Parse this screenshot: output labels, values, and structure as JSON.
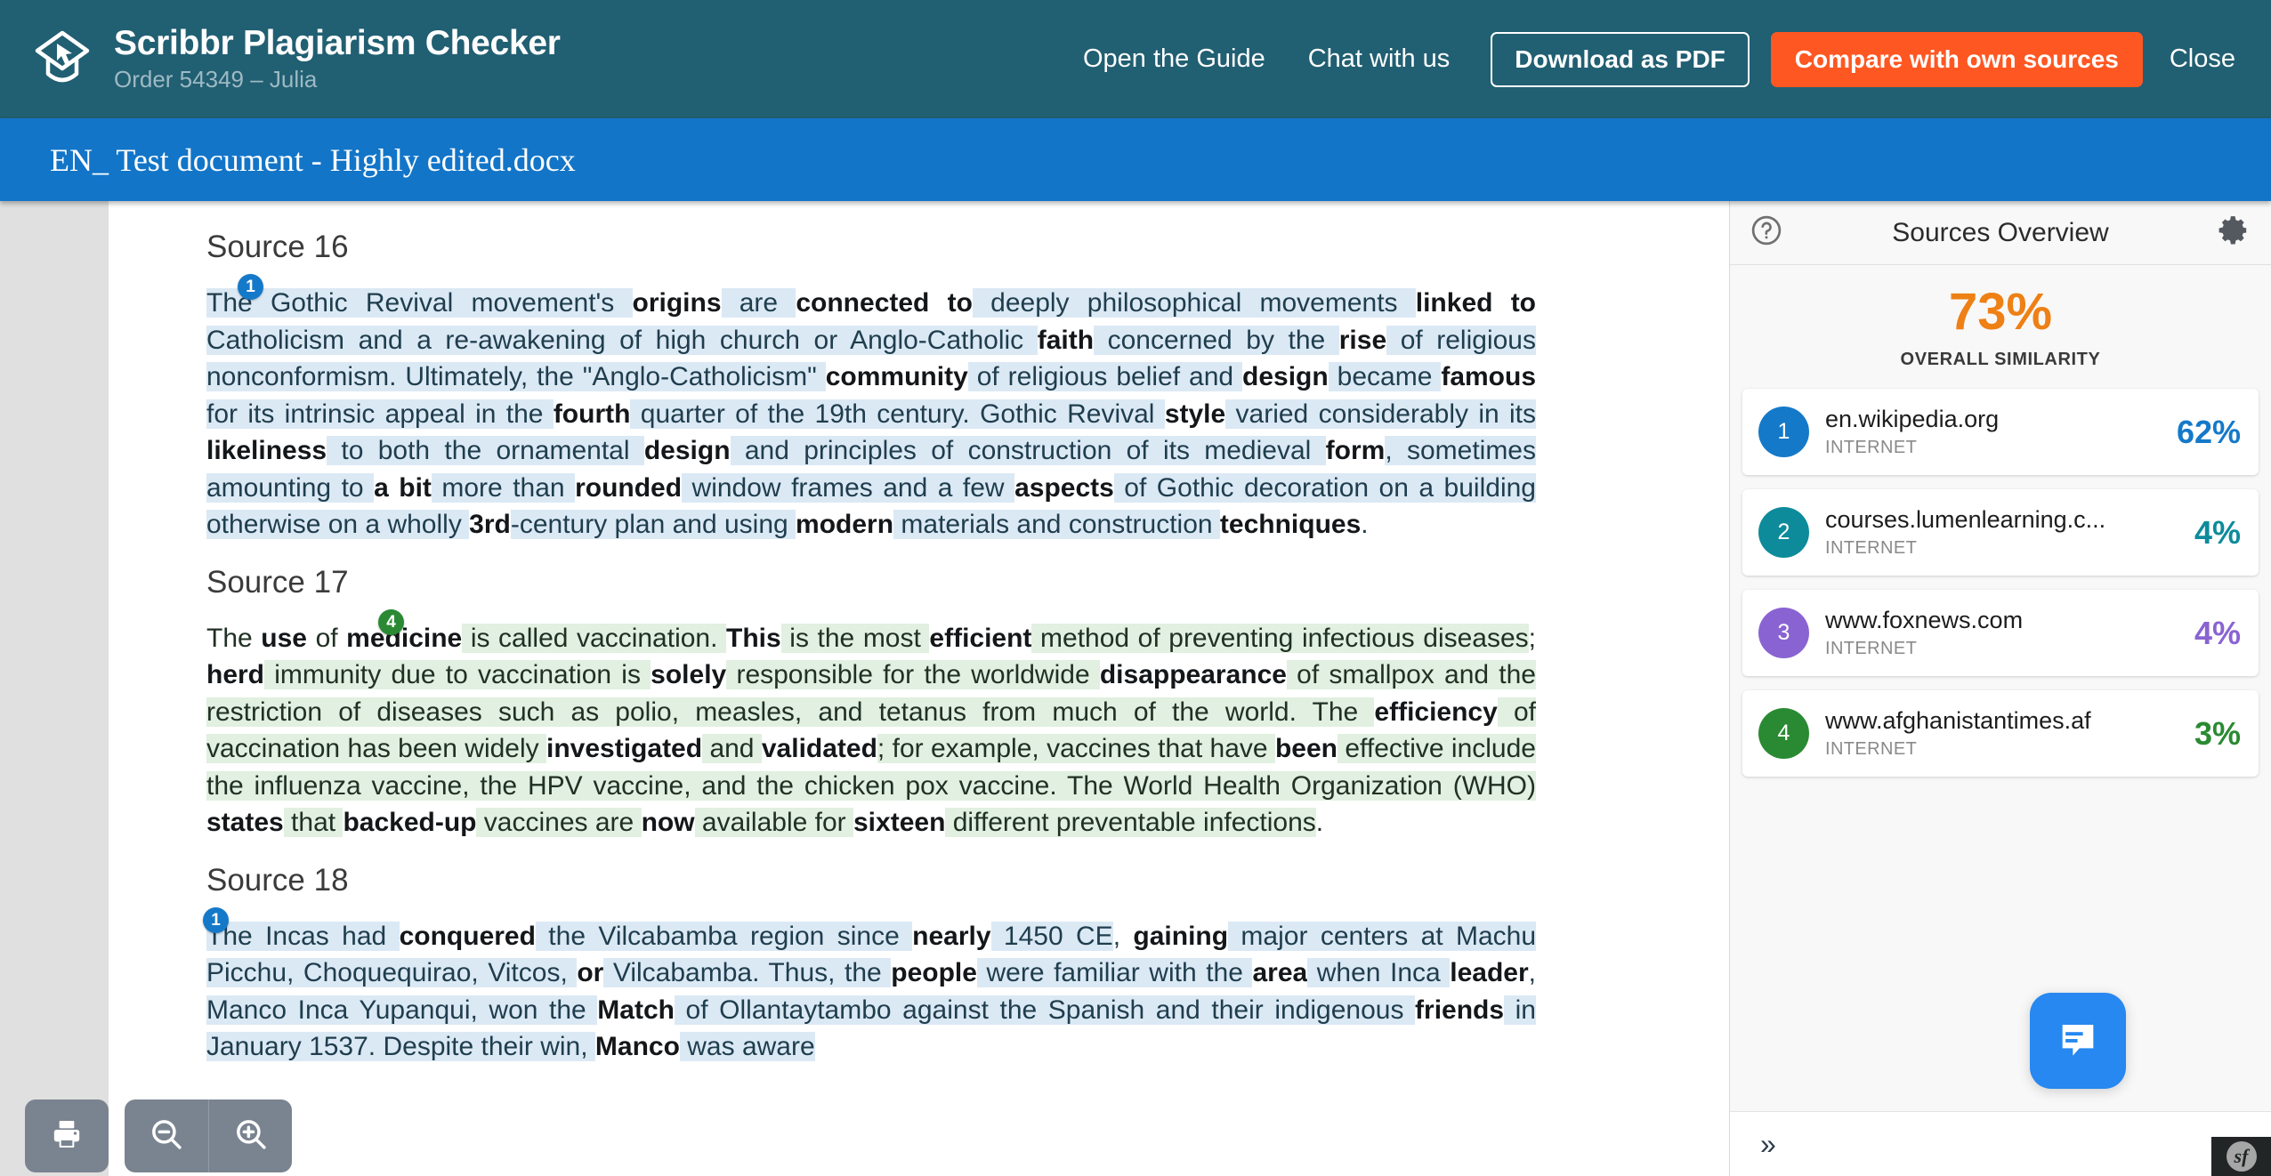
{
  "header": {
    "brand_title": "Scribbr Plagiarism Checker",
    "order_line": "Order 54349 – Julia",
    "logo_icon": "graduation-cap-cursor-logo",
    "nav": {
      "guide_label": "Open the Guide",
      "chat_label": "Chat with us",
      "download_label": "Download as PDF",
      "compare_label": "Compare with own sources",
      "close_label": "Close"
    },
    "accent_orange": "#ff5722",
    "bar_color": "#215f72"
  },
  "filebar": {
    "filename": "EN_ Test document - Highly edited.docx",
    "color": "#1275c8"
  },
  "document": {
    "sections": [
      {
        "heading": "Source 16",
        "badge": "1",
        "badge_color": "#1579c9",
        "highlight": "blue",
        "text": "The Gothic Revival movement's origins are connected to deeply philosophical movements linked to Catholicism and a re-awakening of high church or Anglo-Catholic faith concerned by the rise of religious nonconformism. Ultimately, the \"Anglo-Catholicism\" community of religious belief and design became famous for its intrinsic appeal in the fourth quarter of the 19th century. Gothic Revival style varied considerably in its likeliness to both the ornamental design and principles of construction of its medieval form, sometimes amounting to a bit more than rounded window frames and a few aspects of Gothic decoration on a building otherwise on a wholly 3rd-century plan and using modern materials and construction techniques."
      },
      {
        "heading": "Source 17",
        "badge": "4",
        "badge_color": "#2a8a33",
        "highlight": "green",
        "text": "The use of medicine is called vaccination. This is the most efficient method of preventing infectious diseases; herd immunity due to vaccination is solely responsible for the worldwide disappearance of smallpox and the restriction of diseases such as polio, measles, and tetanus from much of the world. The efficiency of vaccination has been widely investigated and validated; for example, vaccines that have been effective include the influenza vaccine, the HPV vaccine, and the chicken pox vaccine. The World Health Organization (WHO) states that backed-up vaccines are now available for sixteen different preventable infections."
      },
      {
        "heading": "Source 18",
        "badge": "1",
        "badge_color": "#1579c9",
        "highlight": "blue",
        "text": "The Incas had conquered the Vilcabamba region since nearly 1450 CE, gaining major centers at Machu Picchu, Choquequirao, Vitcos, or Vilcabamba. Thus, the people were familiar with the area when Inca leader, Manco Inca Yupanqui, won the Match of Ollantaytambo against the Spanish and their indigenous friends in January 1537. Despite their win, Manco was aware"
      }
    ]
  },
  "tools": {
    "print_icon": "printer-icon",
    "zoom_out_icon": "zoom-out-icon",
    "zoom_in_icon": "zoom-in-icon"
  },
  "sidebar": {
    "help_icon": "help-circle-icon",
    "title": "Sources Overview",
    "settings_icon": "gear-icon",
    "overall_percent": "73%",
    "overall_label": "OVERALL SIMILARITY",
    "overall_color": "#ee8015",
    "type_label": "INTERNET",
    "sources": [
      {
        "index": "1",
        "url": "en.wikipedia.org",
        "type": "INTERNET",
        "percent": "62%",
        "color": "#1579c9"
      },
      {
        "index": "2",
        "url": "courses.lumenlearning.c...",
        "type": "INTERNET",
        "percent": "4%",
        "color": "#0d8b9b"
      },
      {
        "index": "3",
        "url": "www.foxnews.com",
        "type": "INTERNET",
        "percent": "4%",
        "color": "#8a63d2"
      },
      {
        "index": "4",
        "url": "www.afghanistantimes.af",
        "type": "INTERNET",
        "percent": "3%",
        "color": "#2a8a33"
      }
    ],
    "expand_icon": "double-chevron-right-icon"
  },
  "overlays": {
    "chat_icon": "chat-bubble-icon",
    "chat_color": "#2688f0",
    "debug_badge": "sf"
  }
}
